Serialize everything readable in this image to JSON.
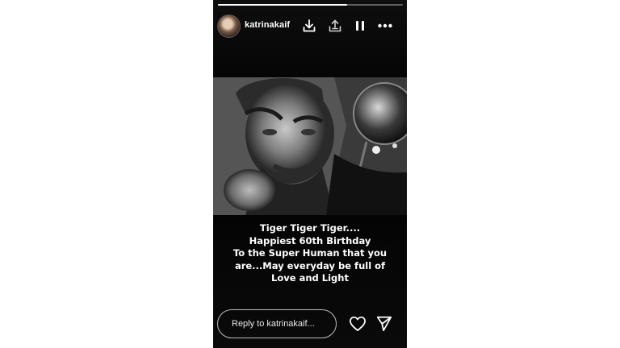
{
  "story": {
    "progress": 0.7,
    "username": "katrinakaif",
    "caption": [
      "Tiger Tiger Tiger....",
      "Happiest 60th Birthday",
      "To the Super Human that you",
      "are...May everyday be full of",
      "Love and Light"
    ],
    "reply_placeholder": "Reply to katrinakaif..."
  },
  "icons": {
    "download": "download-icon",
    "share": "share-to-icon",
    "pause": "pause-icon",
    "more": "more-options-icon",
    "like": "heart-icon",
    "send": "send-icon"
  },
  "colors": {
    "background": "#000000",
    "text": "#ffffff",
    "page": "#ffffff"
  }
}
